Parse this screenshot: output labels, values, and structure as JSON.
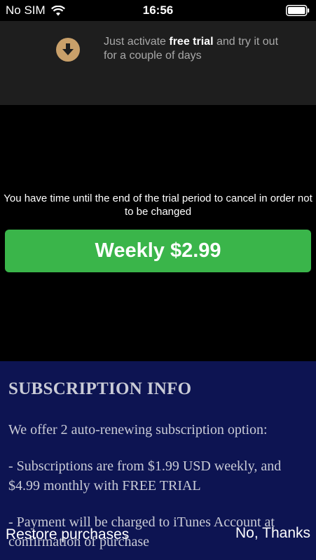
{
  "status_bar": {
    "carrier": "No SIM",
    "time": "16:56"
  },
  "banner": {
    "text_before": "Just activate ",
    "text_bold": "free trial",
    "text_after": " and try it out for a couple of days",
    "icon": "download-icon",
    "icon_color": "#c9a06a"
  },
  "notice": "You have time until the end of the trial period to cancel in order not to be changed",
  "purchase_button": {
    "label": "Weekly $2.99",
    "color": "#3ab54a"
  },
  "subscription_info": {
    "title": "SUBSCRIPTION INFO",
    "paragraphs": [
      "We offer 2 auto-renewing subscription option:",
      "- Subscriptions are from $1.99 USD weekly, and $4.99 monthly with FREE TRIAL",
      "- Payment will be charged to iTunes Account at confirmation of purchase"
    ],
    "background": "#0d1452"
  },
  "footer": {
    "restore_label": "Restore purchases",
    "dismiss_label": "No, Thanks"
  }
}
